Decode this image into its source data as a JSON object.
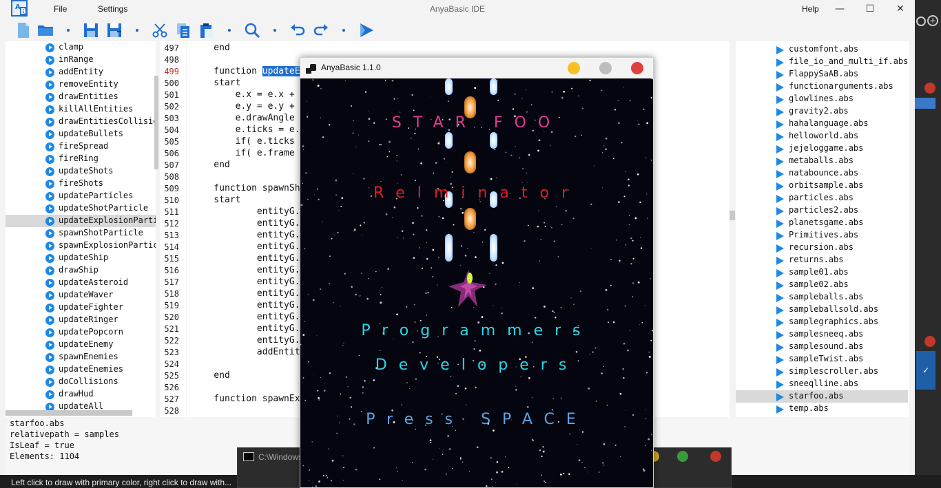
{
  "window": {
    "title": "AnyaBasic IDE",
    "menu": {
      "file": "File",
      "settings": "Settings",
      "help": "Help"
    }
  },
  "toolbar": {
    "icons": [
      "new-file-icon",
      "open-folder-icon",
      "save-icon",
      "save-as-icon",
      "cut-icon",
      "copy-icon",
      "paste-icon",
      "search-icon",
      "undo-icon",
      "redo-icon",
      "run-icon"
    ]
  },
  "functions": {
    "items": [
      "clamp",
      "inRange",
      "addEntity",
      "removeEntity",
      "drawEntities",
      "killAllEntities",
      "drawEntitiesCollisio",
      "updateBullets",
      "fireSpread",
      "fireRing",
      "updateShots",
      "fireShots",
      "updateParticles",
      "updateShotParticle",
      "updateExplosionParti",
      "spawnShotParticle",
      "spawnExplosionPartic",
      "updateShip",
      "drawShip",
      "updateAsteroid",
      "updateWaver",
      "updateFighter",
      "updateRinger",
      "updatePopcorn",
      "updateEnemy",
      "spawnEnemies",
      "updateEnemies",
      "doCollisions",
      "drawHud",
      "updateAll"
    ],
    "selected_index": 14
  },
  "editor": {
    "line_numbers": [
      "497",
      "498",
      "499",
      "500",
      "501",
      "502",
      "503",
      "504",
      "505",
      "506",
      "507",
      "508",
      "509",
      "510",
      "511",
      "512",
      "513",
      "514",
      "515",
      "516",
      "517",
      "518",
      "519",
      "520",
      "521",
      "522",
      "523",
      "524",
      "525",
      "526",
      "527",
      "528"
    ],
    "highlight_line": "499",
    "lines": [
      "    end",
      "",
      "    function ",
      "    start",
      "        e.x = e.x +",
      "        e.y = e.y +",
      "        e.drawAngle",
      "        e.ticks = e.",
      "        if( e.ticks",
      "        if( e.frame",
      "    end",
      "",
      "    function spawnSh",
      "    start",
      "            entityG.",
      "            entityG.",
      "            entityG.",
      "            entityG.",
      "            entityG.",
      "            entityG.",
      "            entityG.",
      "            entityG.",
      "            entityG.",
      "            entityG.",
      "            entityG.",
      "            entityG.",
      "            addEntit",
      "",
      "    end",
      "",
      "    function spawnEx",
      ""
    ],
    "selected_token": "updateE"
  },
  "files": {
    "items": [
      "customfont.abs",
      "file_io_and_multi_if.abs",
      "FlappySaAB.abs",
      "functionarguments.abs",
      "glowlines.abs",
      "gravity2.abs",
      "hahalanguage.abs",
      "helloworld.abs",
      "jejeloggame.abs",
      "metaballs.abs",
      "natabounce.abs",
      "orbitsample.abs",
      "particles.abs",
      "particles2.abs",
      "planetsgame.abs",
      "Primitives.abs",
      "recursion.abs",
      "returns.abs",
      "sample01.abs",
      "sample02.abs",
      "sampleballs.abs",
      "sampleballsold.abs",
      "samplegraphics.abs",
      "samplesneeq.abs",
      "samplesound.abs",
      "sampleTwist.abs",
      "simplescroller.abs",
      "sneeqlline.abs",
      "starfoo.abs",
      "temp.abs"
    ],
    "selected_index": 28
  },
  "info": {
    "lines": [
      "starfoo.abs",
      "relativepath = samples",
      "IsLeaf = true",
      "Elements: 1104"
    ]
  },
  "status": {
    "text": "Left click to draw with primary color, right click to draw with..."
  },
  "cmd": {
    "title": "C:\\Windows"
  },
  "game": {
    "title": "AnyaBasic 1.1.0",
    "texts": {
      "title": "STAR FOO",
      "subtitle": "Relminator",
      "credit1": "Programmers",
      "credit2": "Developers",
      "prompt": "Press SPACE"
    },
    "colors": {
      "title": "#e23d8e",
      "subtitle": "#e51c23",
      "credits": "#28d8e8",
      "prompt": "#5aa6e8"
    }
  }
}
